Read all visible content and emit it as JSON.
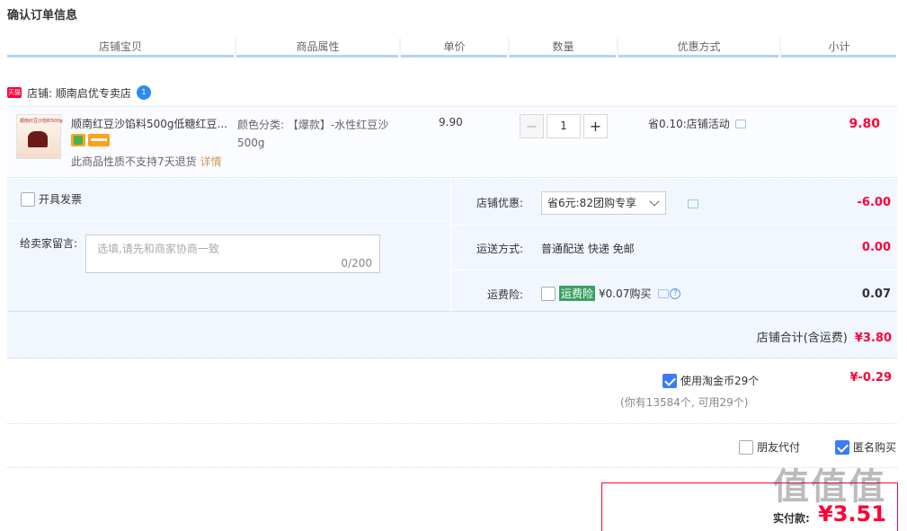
{
  "page": {
    "title": "确认订单信息"
  },
  "table_headers": [
    "店铺宝贝",
    "商品属性",
    "单价",
    "数量",
    "优惠方式",
    "小计"
  ],
  "shop": {
    "tag": "天猫",
    "label": "店铺: 顺南启优专卖店",
    "ww_icon_text": "1"
  },
  "item": {
    "thumb_text": "顺南红豆沙馅料500g",
    "name": "顺南红豆沙馅料500g低糖红豆...",
    "attr_label": "颜色分类: ",
    "attr_value": "【爆款】-水性红豆沙500g",
    "price": "9.90",
    "qty_minus": "−",
    "qty": "1",
    "qty_plus": "+",
    "promo": "省0.10:店铺活动",
    "no_return": "此商品性质不支持7天退货",
    "detail_link": "详情",
    "subtotal": "9.80"
  },
  "options": {
    "invoice_label": "开具发票",
    "memo_label": "给卖家留言:",
    "memo_placeholder": "选填,请先和商家协商一致",
    "memo_count": "0/200",
    "shop_discount_label": "店铺优惠:",
    "shop_discount_value": "省6元:82团购专享",
    "shop_discount_amount": "-6.00",
    "shipping_label": "运送方式:",
    "shipping_value": "普通配送 快递 免邮",
    "shipping_amount": "0.00",
    "insurance_label": "运费险:",
    "insurance_tag": "运费险",
    "insurance_value": "¥0.07购买",
    "insurance_amount": "0.07"
  },
  "shop_total": {
    "label": "店铺合计(含运费)",
    "amount": "¥3.80"
  },
  "coins": {
    "label": "使用淘金币29个",
    "sub": "(你有13584个, 可用29个)",
    "amount": "¥-0.29",
    "checked": true
  },
  "pay_options": {
    "friend_pay": "朋友代付",
    "anonymous": "匿名购买"
  },
  "payment": {
    "label": "实付款:",
    "amount": "¥3.51"
  },
  "watermark": "值值值",
  "colors": {
    "accent": "#ff0036",
    "header_line": "#b2d1ff",
    "panel_bg": "#f2f7ff"
  }
}
